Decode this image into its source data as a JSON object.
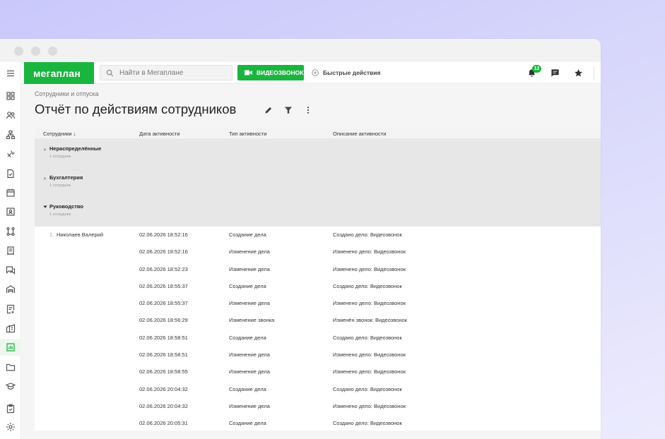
{
  "app": {
    "logo": "мегаплан",
    "search_placeholder": "Найти в Мегаплане",
    "video_button": "ВИДЕОЗВОНОК",
    "quick_actions": "Быстрые действия",
    "notifications_count": "12",
    "accent_color": "#19b53f"
  },
  "sidebar": {
    "icons": [
      "menu-icon",
      "grid-icon",
      "users-icon",
      "hierarchy-icon",
      "tools-icon",
      "task-icon",
      "calendar-icon",
      "contact-card-icon",
      "workflow-icon",
      "document-icon",
      "chat-icon",
      "warehouse-icon",
      "invoice-icon",
      "building-icon",
      "report-icon",
      "folder-icon",
      "education-icon",
      "clipboard-icon",
      "settings-icon"
    ],
    "active": "report-icon"
  },
  "page": {
    "breadcrumb": "Сотрудники и отпуска",
    "title": "Отчёт по действиям сотрудников"
  },
  "table": {
    "columns": [
      "Сотрудники ↓",
      "Дата активности",
      "Тип активности",
      "Описание активности"
    ],
    "groups": [
      {
        "name": "Нераспределённые",
        "count": "1 сотрудник",
        "expanded": false
      },
      {
        "name": "Бухгалтерия",
        "count": "1 сотрудник",
        "expanded": false
      },
      {
        "name": "Руководство",
        "count": "1 сотрудник",
        "expanded": true
      }
    ],
    "employee": {
      "num": "1.",
      "name": "Николаев Валерий"
    },
    "rows": [
      {
        "date": "02.06.2026 18:52:16",
        "type": "Создание дела",
        "desc": "Создано дело: Видеозвонок"
      },
      {
        "date": "02.06.2026 18:52:16",
        "type": "Изменение дела",
        "desc": "Изменено дело: Видеозвонок"
      },
      {
        "date": "02.06.2026 18:52:23",
        "type": "Изменение дела",
        "desc": "Изменено дело: Видеозвонок"
      },
      {
        "date": "02.06.2026 18:55:37",
        "type": "Создание дела",
        "desc": "Создано дело: Видеозвонок"
      },
      {
        "date": "02.06.2026 18:55:37",
        "type": "Изменение дела",
        "desc": "Изменено дело: Видеозвонок"
      },
      {
        "date": "02.06.2026 18:56:29",
        "type": "Изменение звонка",
        "desc": "Изменён звонок: Видеозвонок"
      },
      {
        "date": "02.06.2026 18:58:51",
        "type": "Создание дела",
        "desc": "Создано дело: Видеозвонок"
      },
      {
        "date": "02.06.2026 18:58:51",
        "type": "Изменение дела",
        "desc": "Изменено дело: Видеозвонок"
      },
      {
        "date": "02.06.2026 18:58:55",
        "type": "Изменение дела",
        "desc": "Изменено дело: Видеозвонок"
      },
      {
        "date": "02.06.2026 20:04:32",
        "type": "Создание дела",
        "desc": "Создано дело: Видеозвонок"
      },
      {
        "date": "02.06.2026 20:04:32",
        "type": "Изменение дела",
        "desc": "Изменено дело: Видеозвонок"
      },
      {
        "date": "02.06.2026 20:05:31",
        "type": "Создание дела",
        "desc": "Создано дело: Видеозвонок"
      }
    ]
  }
}
